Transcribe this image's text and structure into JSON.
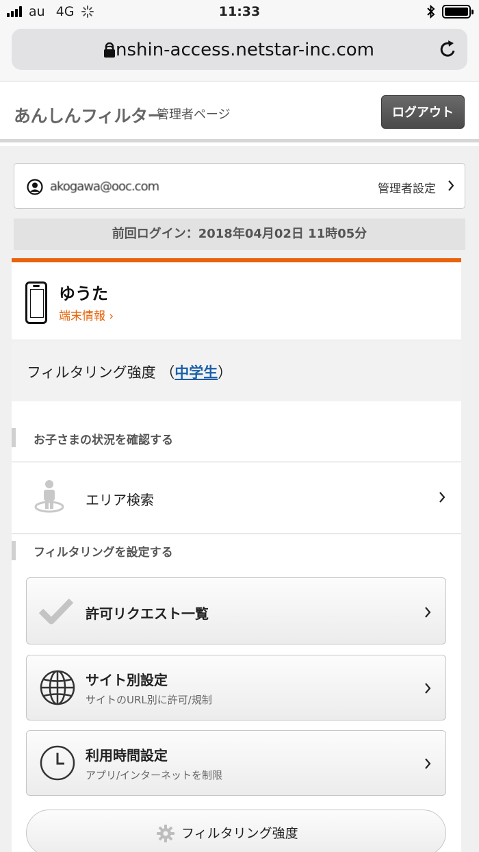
{
  "status_bar": {
    "carrier": "au",
    "network": "4G",
    "time": "11:33"
  },
  "browser": {
    "url": "anshin-access.netstar-inc.com"
  },
  "header": {
    "logo": "あんしんフィルター",
    "subtitle": "管理者ページ",
    "logout_label": "ログアウト"
  },
  "account": {
    "email": "akogawa@ooc.com",
    "settings_label": "管理者設定"
  },
  "last_login": "前回ログイン：2018年04月02日 11時05分",
  "device": {
    "name": "ゆうた",
    "info_link": "端末情報 ›"
  },
  "filter_strength": {
    "label": "フィルタリング強度",
    "open": "（",
    "level": "中学生",
    "close": "）"
  },
  "sections": {
    "check_child": "お子さまの状況を確認する",
    "set_filtering": "フィルタリングを設定する"
  },
  "area_search": {
    "label": "エリア検索"
  },
  "menu": {
    "permission_requests": {
      "title": "許可リクエスト一覧"
    },
    "site_settings": {
      "title": "サイト別設定",
      "sub": "サイトのURL別に許可/規制"
    },
    "usage_time": {
      "title": "利用時間設定",
      "sub": "アプリ/インターネットを制限"
    }
  },
  "strength_button": {
    "label": "フィルタリング強度"
  },
  "colors": {
    "accent": "#e8630a",
    "link": "#1a5fa8",
    "logout_bg": "#555555"
  }
}
